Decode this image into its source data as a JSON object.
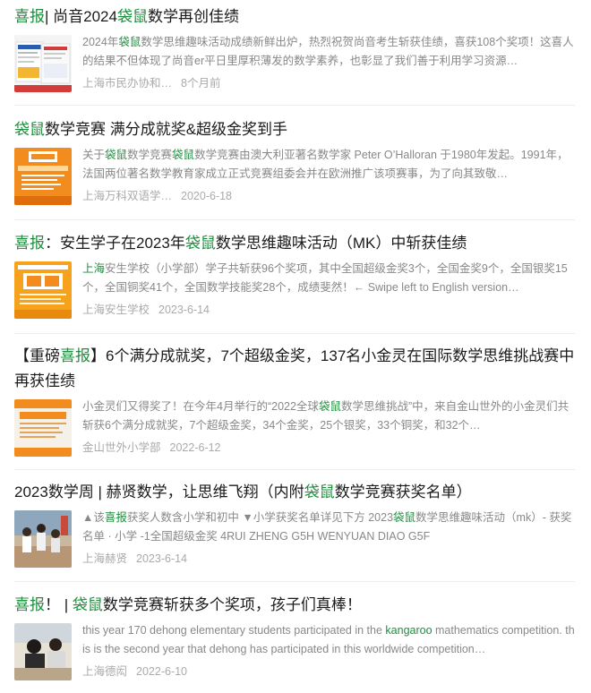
{
  "items": [
    {
      "title_parts": [
        {
          "text": "喜报",
          "hl": true
        },
        {
          "text": "| 尚音2024",
          "hl": false
        },
        {
          "text": "袋鼠",
          "hl": true
        },
        {
          "text": "数学再创佳绩",
          "hl": false
        }
      ],
      "snippet_parts": [
        {
          "text": "2024年",
          "hl": false
        },
        {
          "text": "袋鼠",
          "hl": true
        },
        {
          "text": "数学思维趣味活动成绩新鲜出炉，热烈祝贺尚音考生斩获佳绩，喜获108个奖项！这喜人的结果不但体现了尚音er平日里厚积薄发的数学素养，也彰显了我们善于利用学习资源…",
          "hl": false
        }
      ],
      "source": "上海市民办协和…",
      "date": "8个月前",
      "thumb": "math-textbook-thumbnail"
    },
    {
      "title_parts": [
        {
          "text": "袋鼠",
          "hl": true
        },
        {
          "text": "数学竞赛 满分成就奖&超级金奖到手",
          "hl": false
        }
      ],
      "snippet_parts": [
        {
          "text": "关于",
          "hl": false
        },
        {
          "text": "袋鼠",
          "hl": true
        },
        {
          "text": "数学竞赛",
          "hl": false
        },
        {
          "text": "袋鼠",
          "hl": true
        },
        {
          "text": "数学竞赛由澳大利亚著名数学家 Peter O’Halloran 于1980年发起。1991年，法国两位著名数学教育家成立正式竞赛组委会并在欧洲推广该项赛事，为了向其致敬…",
          "hl": false
        }
      ],
      "source": "上海万科双语学…",
      "date": "2020-6-18",
      "thumb": "orange-poster-thumbnail"
    },
    {
      "title_parts": [
        {
          "text": "喜报",
          "hl": true
        },
        {
          "text": "：安生学子在2023年",
          "hl": false
        },
        {
          "text": "袋鼠",
          "hl": true
        },
        {
          "text": "数学思维趣味活动（MK）中斩获佳绩",
          "hl": false
        }
      ],
      "snippet_parts": [
        {
          "text": "上海",
          "hl": true
        },
        {
          "text": "安生学校（小学部）学子共斩获96个奖项，其中全国超级金奖3个，全国金奖9个，全国银奖15个，全国铜奖41个，全国数学技能奖28个，成绩斐然！← Swipe left to English version…",
          "hl": false
        }
      ],
      "source": "上海安生学校",
      "date": "2023-6-14",
      "thumb": "orange-poster-thumbnail"
    },
    {
      "title_parts": [
        {
          "text": "【重磅",
          "hl": false
        },
        {
          "text": "喜报",
          "hl": true
        },
        {
          "text": "】6个满分成就奖，7个超级金奖，137名小金灵在国际数学思维挑战赛中再获佳绩",
          "hl": false
        }
      ],
      "snippet_parts": [
        {
          "text": "小金灵们又得奖了！在今年4月举行的“2022全球",
          "hl": false
        },
        {
          "text": "袋鼠",
          "hl": true
        },
        {
          "text": "数学思维挑战”中，来自金山世外的小金灵们共斩获6个满分成就奖，7个超级金奖，34个金奖，25个银奖，33个铜奖，和32个…",
          "hl": false
        }
      ],
      "source": "金山世外小学部",
      "date": "2022-6-12",
      "thumb": "orange-poster-thumbnail"
    },
    {
      "title_parts": [
        {
          "text": "2023数学周 | 赫贤数学，让思维飞翔（内附",
          "hl": false
        },
        {
          "text": "袋鼠",
          "hl": true
        },
        {
          "text": "数学竞赛获奖名单）",
          "hl": false
        }
      ],
      "snippet_parts": [
        {
          "text": "▲该",
          "hl": false
        },
        {
          "text": "喜报",
          "hl": true
        },
        {
          "text": "获奖人数含小学和初中 ▼小学获奖名单详见下方 2023",
          "hl": false
        },
        {
          "text": "袋鼠",
          "hl": true
        },
        {
          "text": "数学思维趣味活动（mk）- 获奖名单 · 小学 -1全国超级金奖 4RUI ZHENG G5H WENYUAN DIAO G5F",
          "hl": false
        }
      ],
      "source": "上海赫贤",
      "date": "2023-6-14",
      "thumb": "students-photo-thumbnail"
    },
    {
      "title_parts": [
        {
          "text": "喜报",
          "hl": true
        },
        {
          "text": "！ | ",
          "hl": false
        },
        {
          "text": "袋鼠",
          "hl": true
        },
        {
          "text": "数学竞赛斩获多个奖项，孩子们真棒！",
          "hl": false
        }
      ],
      "snippet_parts": [
        {
          "text": "this year 170 dehong elementary students participated in the ",
          "hl": false
        },
        {
          "text": "kangaroo",
          "hl": true
        },
        {
          "text": " mathematics competition. this is the second year that dehong has participated in this worldwide competition…",
          "hl": false
        }
      ],
      "source": "上海德闳",
      "date": "2022-6-10",
      "thumb": "classroom-photo-thumbnail"
    }
  ]
}
